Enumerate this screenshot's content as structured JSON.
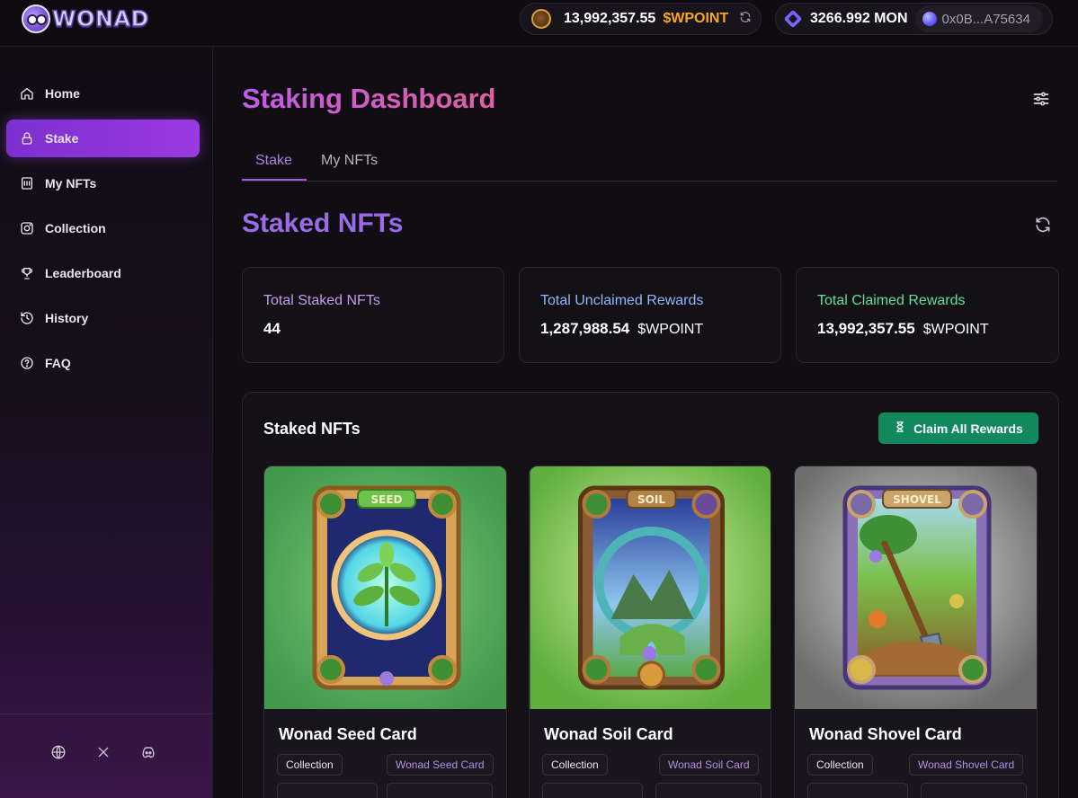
{
  "app": {
    "logo_text": "WONAD"
  },
  "header": {
    "wpoint_amount": "13,992,357.55",
    "wpoint_unit": "$WPOINT",
    "mon_amount": "3266.992 MON",
    "wallet_address": "0x0B...A75634"
  },
  "sidebar": {
    "items": [
      {
        "label": "Home",
        "icon": "home-icon"
      },
      {
        "label": "Stake",
        "icon": "lock-icon",
        "active": true
      },
      {
        "label": "My NFTs",
        "icon": "nft-icon"
      },
      {
        "label": "Collection",
        "icon": "collection-icon"
      },
      {
        "label": "Leaderboard",
        "icon": "trophy-icon"
      },
      {
        "label": "History",
        "icon": "history-icon"
      },
      {
        "label": "FAQ",
        "icon": "help-icon"
      }
    ],
    "socials": [
      "globe-icon",
      "x-icon",
      "discord-icon"
    ]
  },
  "main": {
    "title": "Staking Dashboard",
    "tabs": [
      {
        "label": "Stake",
        "active": true
      },
      {
        "label": "My NFTs"
      }
    ],
    "section_title": "Staked NFTs",
    "stats": [
      {
        "label": "Total Staked NFTs",
        "value": "44",
        "unit": "",
        "color": "#c79bf2"
      },
      {
        "label": "Total Unclaimed Rewards",
        "value": "1,287,988.54",
        "unit": "$WPOINT",
        "color": "#8fb8ff"
      },
      {
        "label": "Total Claimed Rewards",
        "value": "13,992,357.55",
        "unit": "$WPOINT",
        "color": "#5fe0a0"
      }
    ],
    "panel": {
      "title": "Staked NFTs",
      "claim_button": "Claim All Rewards",
      "cards": [
        {
          "name": "Wonad Seed Card",
          "chip_left": "Collection",
          "chip_right": "Wonad Seed Card",
          "banner": "SEED",
          "bg": "#4fb35a"
        },
        {
          "name": "Wonad Soil Card",
          "chip_left": "Collection",
          "chip_right": "Wonad Soil Card",
          "banner": "SOIL",
          "bg": "#8fd465"
        },
        {
          "name": "Wonad Shovel Card",
          "chip_left": "Collection",
          "chip_right": "Wonad Shovel Card",
          "banner": "SHOVEL",
          "bg": "#9a9a9a"
        }
      ]
    }
  },
  "colors": {
    "accent": "#9a3ae0",
    "claim_green": "#12885e",
    "wpoint_orange": "#f5a623"
  }
}
